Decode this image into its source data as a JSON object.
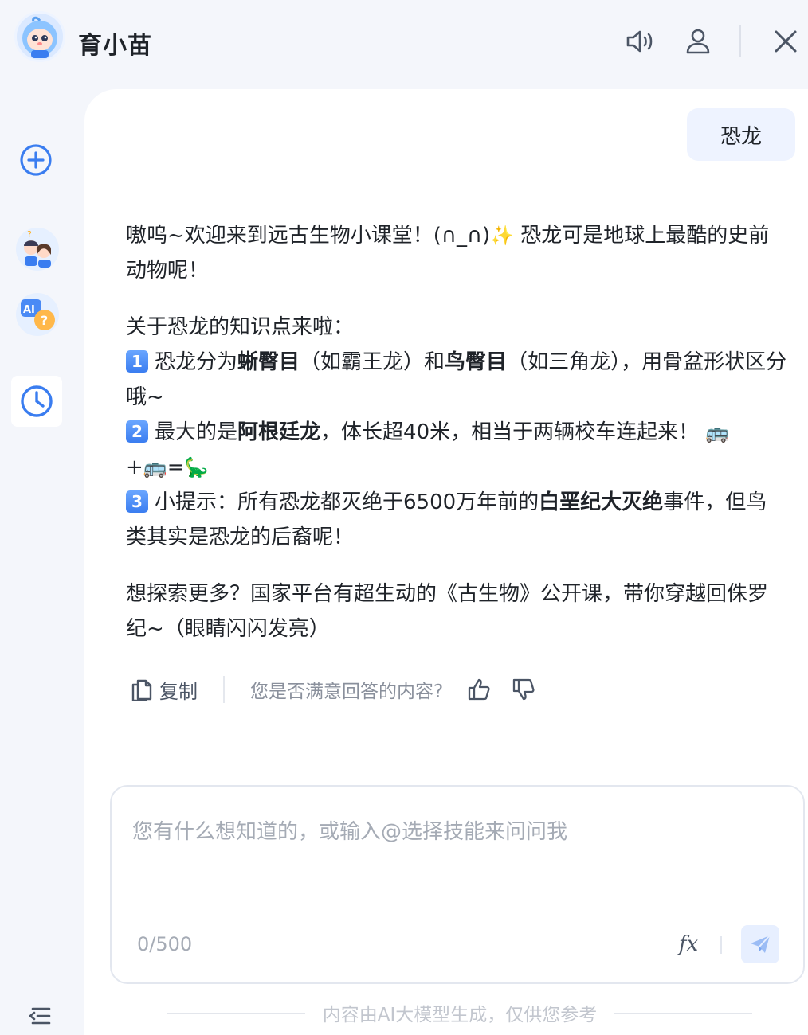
{
  "header": {
    "title": "育小苗",
    "icons": {
      "speaker": "speaker-icon",
      "user": "user-icon",
      "close": "close-icon"
    }
  },
  "sidebar": {
    "icons": [
      "new-chat-icon",
      "student-avatars-icon",
      "ai-qa-icon",
      "history-clock-icon",
      "collapse-menu-icon"
    ]
  },
  "chat": {
    "user_message": "恐龙",
    "answer": {
      "p1_a": "嗷呜~欢迎来到远古生物小课堂！(∩_∩)",
      "p1_sparkle": "✨",
      "p1_b": " 恐龙可是地球上最酷的史前动物呢！",
      "intro": "关于恐龙的知识点来啦：",
      "item1_badge": "1",
      "item1_a": "恐龙分为",
      "item1_bold1": "蜥臀目",
      "item1_b": "（如霸王龙）和",
      "item1_bold2": "鸟臀目",
      "item1_c": "（如三角龙），用骨盆形状区分哦~",
      "item2_badge": "2",
      "item2_a": "最大的是",
      "item2_bold": "阿根廷龙",
      "item2_b": "，体长超40米，相当于两辆校车连起来！",
      "item2_emoji1": "🚌",
      "item2_plus": "+",
      "item2_emoji2": "🚌",
      "item2_eq": "=",
      "item2_emoji3": "🦕",
      "item3_badge": "3",
      "item3_a": "小提示：所有恐龙都灭绝于6500万年前的",
      "item3_bold": "白垩纪大灭绝",
      "item3_b": "事件，但鸟类其实是恐龙的后裔呢！",
      "outro": "想探索更多？国家平台有超生动的《古生物》公开课，带你穿越回侏罗纪~（眼睛闪闪发亮）"
    },
    "feedback": {
      "copy_label": "复制",
      "question": "您是否满意回答的内容?"
    }
  },
  "composer": {
    "placeholder": "您有什么想知道的，或输入@选择技能来问问我",
    "value": "",
    "counter": "0/500",
    "fx_label": "fx"
  },
  "footer": {
    "disclaimer": "内容由AI大模型生成，仅供您参考"
  },
  "colors": {
    "accent": "#3a7df0",
    "background": "#f4f6fb",
    "panel": "#ffffff",
    "user_bubble": "#eef3ff"
  }
}
